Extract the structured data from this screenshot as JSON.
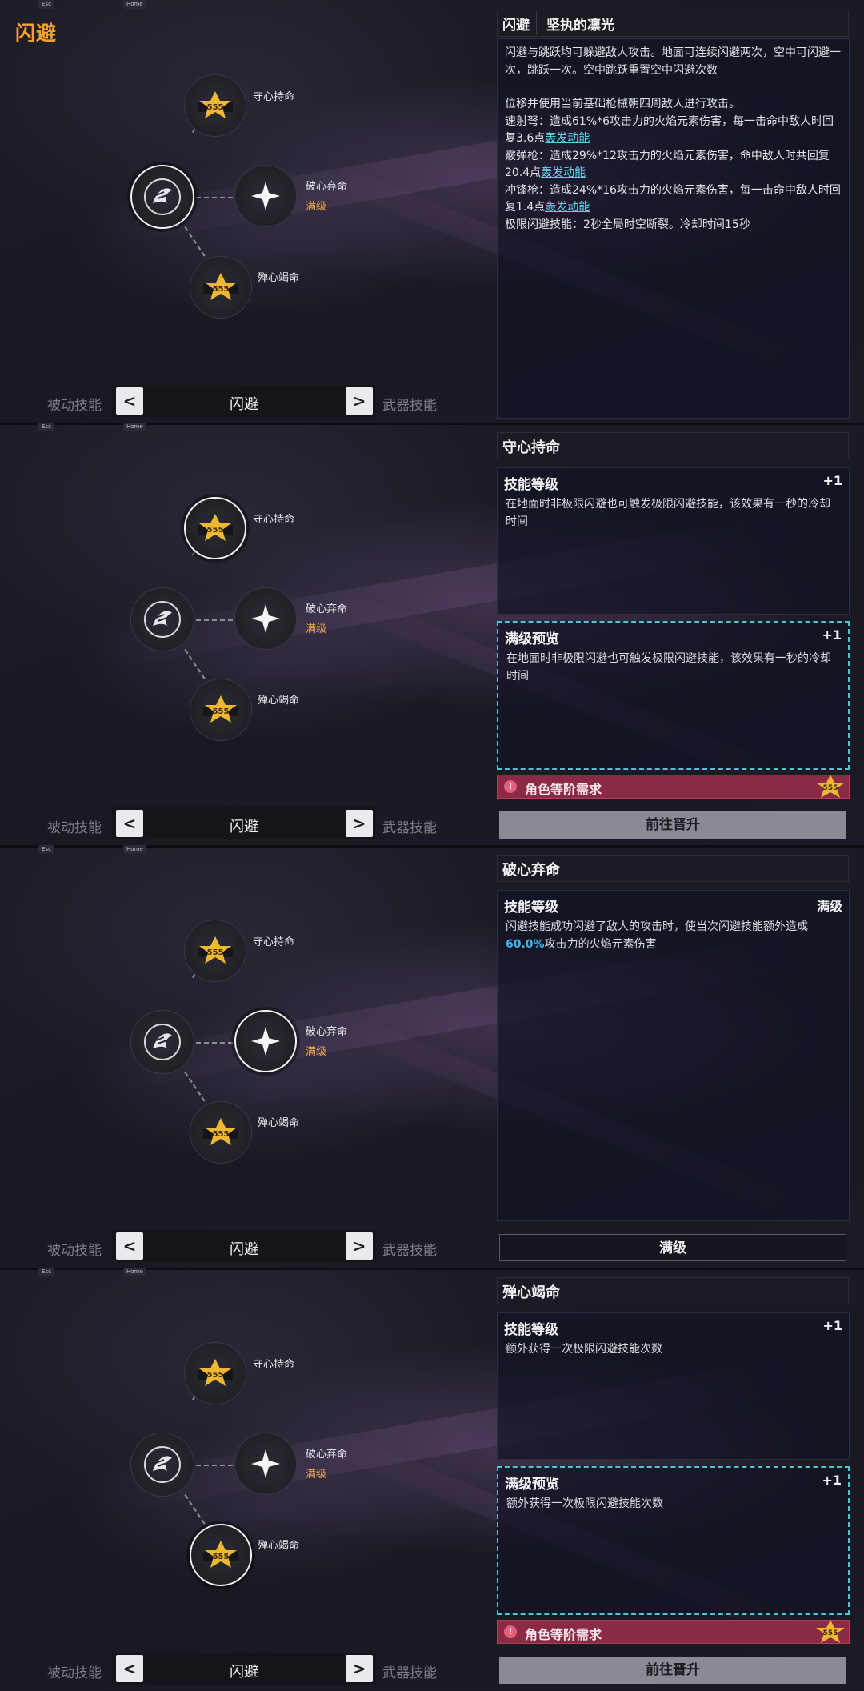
{
  "keys": {
    "esc": "Esc",
    "home": "Home"
  },
  "title": "闪避",
  "tree": {
    "top": "守心持命",
    "right": "破心弃命",
    "right_status": "满级",
    "bottom": "殚心竭命"
  },
  "nav": {
    "left": "被动技能",
    "current": "闪避",
    "right": "武器技能",
    "prev_glyph": "<",
    "next_glyph": ">"
  },
  "colors": {
    "accent": "#f6a12a",
    "highlight": "#3db4ea",
    "link": "#5fd2e8",
    "requirement": "#8a2a45",
    "preview_border": "#4fc3d3"
  },
  "icons": [
    "dodge-skill-icon",
    "rank-star-icon",
    "four-point-star-icon",
    "alert-icon"
  ],
  "panel1": {
    "tag": "闪避",
    "name": "坚执的凛光",
    "p1": "闪避与跳跃均可躲避敌人攻击。地面可连续闪避两次，空中可闪避一次，跳跃一次。空中跳跃重置空中闪避次数",
    "p2": "位移并使用当前基础枪械朝四周敌人进行攻击。",
    "l1_a": "速射弩：造成61%*6攻击力的火焰元素伤害，每一击命中敌人时回复3.6点",
    "l2_a": "霰弹枪：造成29%*12攻击力的火焰元素伤害，命中敌人时共回复20.4点",
    "l3_a": "冲锋枪：造成24%*16攻击力的火焰元素伤害，每一击命中敌人时回复1.4点",
    "link": "轰发动能",
    "p3": "极限闪避技能：2秒全局时空断裂。冷却时间15秒"
  },
  "panel2": {
    "name": "守心持命",
    "box1_title": "技能等级",
    "box1_right": "+1",
    "box1_text": "在地面时非极限闪避也可触发极限闪避技能，该效果有一秒的冷却时间",
    "box2_title": "满级预览",
    "box2_right": "+1",
    "box2_text": "在地面时非极限闪避也可触发极限闪避技能，该效果有一秒的冷却时间",
    "requirement": "角色等阶需求",
    "action": "前往晋升"
  },
  "panel3": {
    "name": "破心弃命",
    "box_title": "技能等级",
    "box_right": "满级",
    "text_a": "闪避技能成功闪避了敌人的攻击时，使当次闪避技能额外造成",
    "text_hl": "60.0%",
    "text_b": "攻击力的火焰元素伤害",
    "action": "满级"
  },
  "panel4": {
    "name": "殚心竭命",
    "box1_title": "技能等级",
    "box1_right": "+1",
    "box1_text": "额外获得一次极限闪避技能次数",
    "box2_title": "满级预览",
    "box2_right": "+1",
    "box2_text": "额外获得一次极限闪避技能次数",
    "requirement": "角色等阶需求",
    "action": "前往晋升"
  }
}
